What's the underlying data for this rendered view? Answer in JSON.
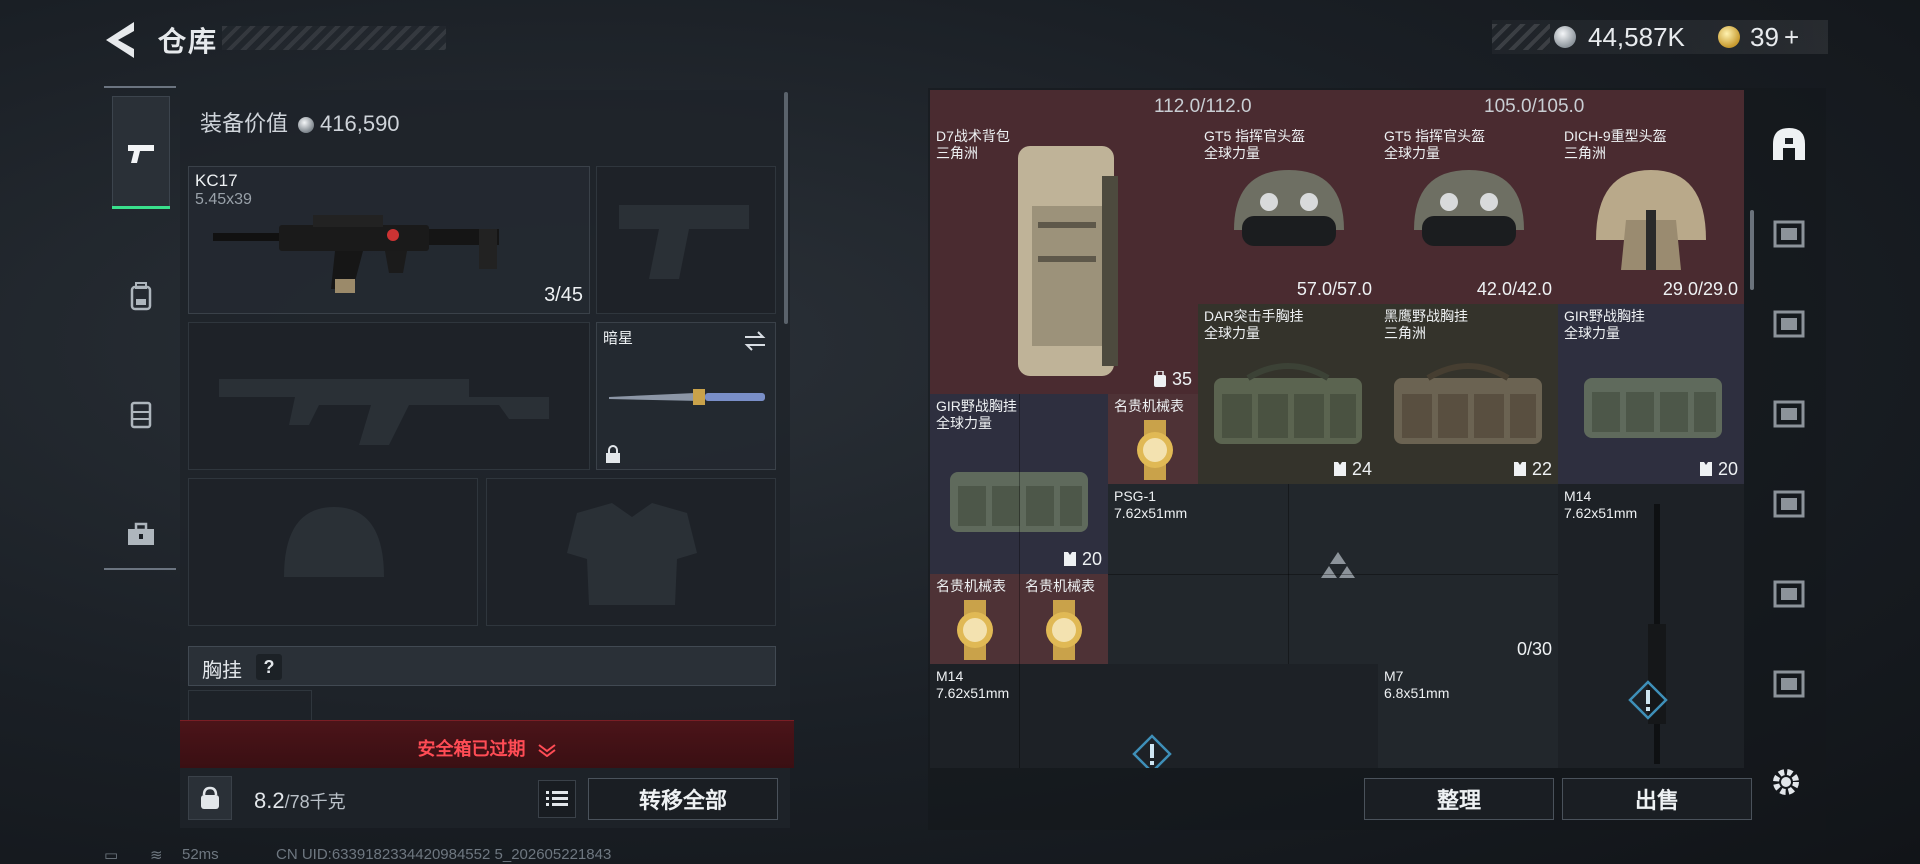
{
  "header": {
    "title": "仓库",
    "currency_silver": "44,587K",
    "currency_gold": "39",
    "add_label": "+"
  },
  "equipment": {
    "value_label": "装备价值",
    "value": "416,590",
    "primary_weapon": {
      "name": "KC17",
      "caliber": "5.45x39",
      "ammo": "3/45"
    },
    "melee": {
      "name": "暗星"
    },
    "vest_label": "胸挂",
    "help": "?",
    "safe_box_text": "安全箱已过期",
    "weight_current": "8.2",
    "weight_max": "/78千克",
    "transfer_all": "转移全部"
  },
  "stash": {
    "top_values": [
      "112.0/112.0",
      "105.0/105.0"
    ],
    "items": {
      "d7": {
        "name": "D7战术背包",
        "source": "三角洲",
        "count": "35"
      },
      "gt5a": {
        "name": "GT5 指挥官头盔",
        "source": "全球力量",
        "durability": "57.0/57.0"
      },
      "gt5b": {
        "name": "GT5 指挥官头盔",
        "source": "全球力量",
        "durability": "42.0/42.0"
      },
      "dich": {
        "name": "DICH-9重型头盔",
        "source": "三角洲",
        "durability": "29.0/29.0"
      },
      "dar": {
        "name": "DAR突击手胸挂",
        "source": "全球力量",
        "count": "24"
      },
      "heiying": {
        "name": "黑鹰野战胸挂",
        "source": "三角洲",
        "count": "22"
      },
      "gir1": {
        "name": "GIR野战胸挂",
        "source": "全球力量",
        "count": "20"
      },
      "gir2": {
        "name": "GIR野战胸挂",
        "source": "全球力量",
        "count": "20"
      },
      "watch1": {
        "name": "名贵机械表"
      },
      "watch2": {
        "name": "名贵机械表"
      },
      "watch3": {
        "name": "名贵机械表"
      },
      "psg": {
        "name": "PSG-1",
        "caliber": "7.62x51mm",
        "ammo": "0/30"
      },
      "m14a": {
        "name": "M14",
        "caliber": "7.62x51mm"
      },
      "m14b": {
        "name": "M14",
        "caliber": "7.62x51mm"
      },
      "m7": {
        "name": "M7",
        "caliber": "6.8x51mm"
      }
    },
    "sort_label": "整理",
    "sell_label": "出售"
  },
  "status": {
    "ping": "52ms",
    "uid": "CN UID:6339182334420984552 5_202605221843"
  },
  "colors": {
    "accent_green": "#39e08c",
    "alert_red": "#ff4c55",
    "rarity_red": "#4a2b30",
    "rarity_purple": "#2e2f3f"
  },
  "icons": [
    "back-arrow-icon",
    "pistol-icon",
    "backpack-icon",
    "vest-icon",
    "toolbox-icon",
    "weight-icon",
    "list-icon",
    "settings-icon"
  ]
}
